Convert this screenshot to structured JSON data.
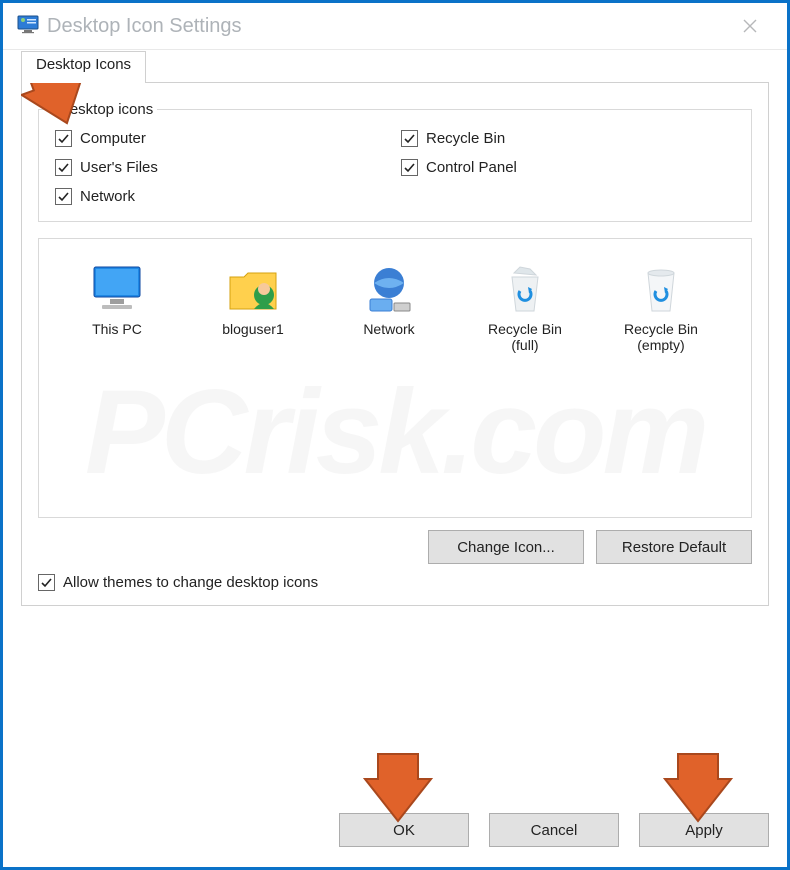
{
  "title": "Desktop Icon Settings",
  "tabs": {
    "desktop": "Desktop Icons"
  },
  "group": {
    "legend": "Desktop icons",
    "items": [
      {
        "id": "computer",
        "label": "Computer",
        "checked": true
      },
      {
        "id": "usersfiles",
        "label": "User's Files",
        "checked": true
      },
      {
        "id": "network",
        "label": "Network",
        "checked": true
      },
      {
        "id": "recyclebin",
        "label": "Recycle Bin",
        "checked": true
      },
      {
        "id": "controlpanel",
        "label": "Control Panel",
        "checked": true
      }
    ]
  },
  "preview": {
    "thispc": {
      "label1": "This PC",
      "label2": ""
    },
    "bloguser1": {
      "label1": "bloguser1",
      "label2": ""
    },
    "network": {
      "label1": "Network",
      "label2": ""
    },
    "recyclefull": {
      "label1": "Recycle Bin",
      "label2": "(full)"
    },
    "recycleempty": {
      "label1": "Recycle Bin",
      "label2": "(empty)"
    }
  },
  "buttons": {
    "change_icon": "Change Icon...",
    "restore_default": "Restore Default",
    "ok": "OK",
    "cancel": "Cancel",
    "apply": "Apply"
  },
  "allow_themes": {
    "label": "Allow themes to change desktop icons",
    "checked": true
  }
}
